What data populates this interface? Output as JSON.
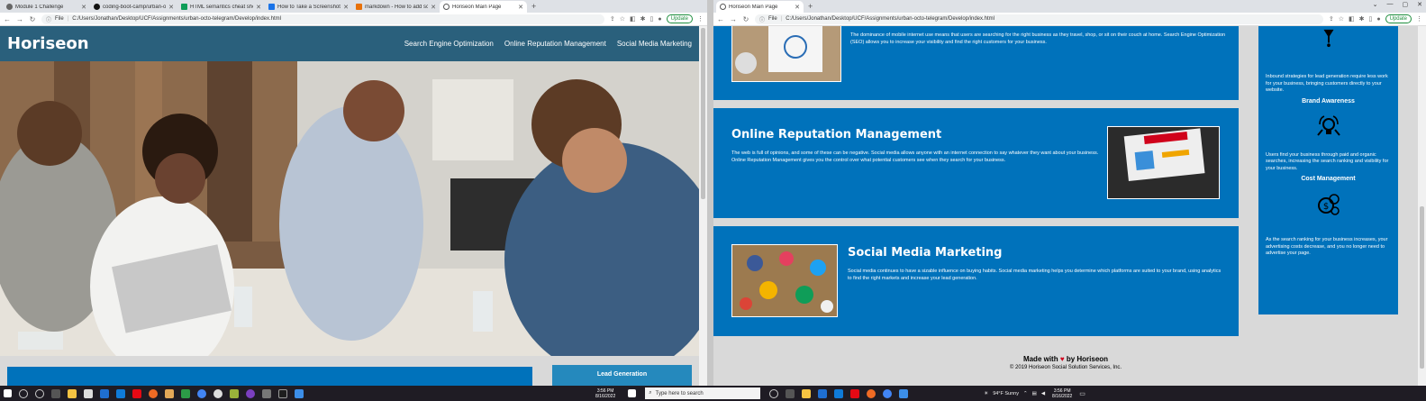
{
  "left_window": {
    "tabs": [
      {
        "label": "Module 1 Challenge",
        "icon": "page-icon",
        "active": false
      },
      {
        "label": "coding-boot-camp/urban-octo-...",
        "icon": "github-icon",
        "active": false
      },
      {
        "label": "HTML semantics cheat sheet - W...",
        "icon": "sheet-icon",
        "active": false
      },
      {
        "label": "How to Take a Screenshot on yo...",
        "icon": "article-icon",
        "active": false
      },
      {
        "label": "markdown - How to add screen...",
        "icon": "stackoverflow-icon",
        "active": false
      },
      {
        "label": "Horiseon Main Page",
        "icon": "globe-icon",
        "active": true
      }
    ],
    "address_prefix": "File",
    "address": "C:/Users/Jonathan/Desktop/UCF/Assignments/urban-octo-telegram/Develop/index.html",
    "update_label": "Update",
    "page": {
      "brand": "Horiseon",
      "nav": [
        "Search Engine Optimization",
        "Online Reputation Management",
        "Social Media Marketing"
      ],
      "sidebar_first_heading": "Lead Generation"
    }
  },
  "right_window": {
    "tabs": [
      {
        "label": "Horiseon Main Page",
        "icon": "globe-icon",
        "active": true
      }
    ],
    "address_prefix": "File",
    "address": "C:/Users/Jonathan/Desktop/UCF/Assignments/urban-octo-telegram/Develop/index.html",
    "update_label": "Update",
    "page": {
      "seo_text": "The dominance of mobile internet use means that users are searching for the right business as they travel, shop, or sit on their couch at home. Search Engine Optimization (SEO) allows you to increase your visibility and find the right customers for your business.",
      "orm_title": "Online Reputation Management",
      "orm_text": "The web is full of opinions, and some of these can be negative. Social media allows anyone with an internet connection to say whatever they want about your business. Online Reputation Management gives you the control over what potential customers see when they search for your business.",
      "smm_title": "Social Media Marketing",
      "smm_text": "Social media continues to have a sizable influence on buying habits. Social media marketing helps you determine which platforms are suited to your brand, using analytics to find the right markets and increase your lead generation.",
      "sidebar": {
        "lead_text": "Inbound strategies for lead generation require less work for your business, bringing customers directly to your website.",
        "brand_heading": "Brand Awareness",
        "brand_text": "Users find your business through paid and organic searches, increasing the search ranking and visibility for your business.",
        "cost_heading": "Cost Management",
        "cost_text": "As the search ranking for your business increases, your advertising costs decrease, and you no longer need to advertise your page."
      },
      "footer_made": "Made with",
      "footer_by": "by Horiseon",
      "footer_copy": "© 2019 Horiseon Social Solution Services, Inc."
    }
  },
  "taskbar": {
    "search_placeholder": "Type here to search",
    "left_time": "3:56 PM",
    "left_date": "8/16/2022",
    "weather": "94°F  Sunny",
    "right_time": "3:56 PM",
    "right_date": "8/16/2022"
  }
}
